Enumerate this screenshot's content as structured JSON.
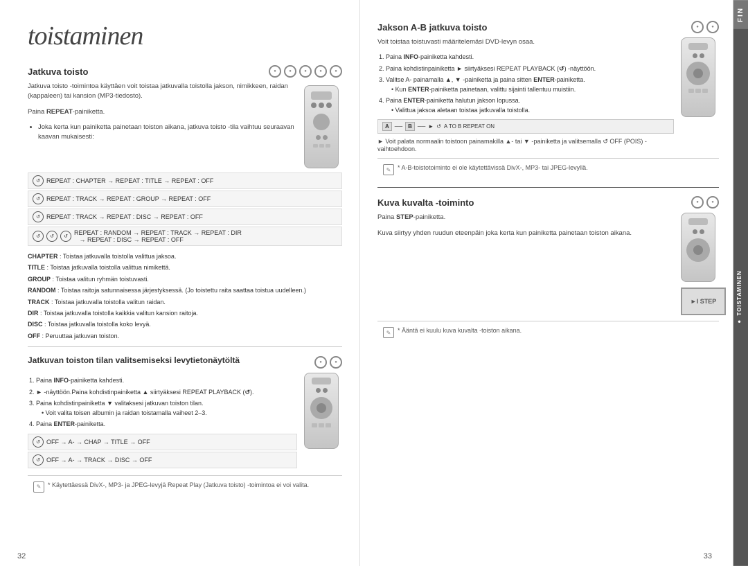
{
  "page": {
    "title": "toistaminen",
    "page_left": "32",
    "page_right": "33"
  },
  "right_tabs": {
    "fin_label": "FIN",
    "toistaminen_label": "● TOISTAMINEN"
  },
  "left_column": {
    "section1": {
      "title": "Jatkuva toisto",
      "icons": [
        "disc1",
        "disc2",
        "disc3",
        "disc4",
        "disc5"
      ],
      "body": "Jatkuva toisto -toimintoa käyttäen voit toistaa jatkuvalla toistolla jakson, nimikkeen, raidan (kappaleen) tai kansion (MP3-tiedosto).",
      "press_label": "Paina REPEAT-painiketta.",
      "bullet1": "Joka kerta kun painiketta painetaan toiston aikana, jatkuva toisto -tila vaihtuu seuraavan kaavan mukaisesti:"
    },
    "repeat_rows": [
      {
        "id": "row1",
        "text": "REPEAT : CHAPTER → REPEAT : TITLE → REPEAT : OFF"
      },
      {
        "id": "row2",
        "text": "REPEAT : TRACK → REPEAT : GROUP → REPEAT : OFF"
      },
      {
        "id": "row3",
        "text": "REPEAT : TRACK → REPEAT : DISC → REPEAT : OFF"
      },
      {
        "id": "row4",
        "text": "REPEAT : RANDOM → REPEAT : TRACK → REPEAT : DIR → REPEAT : DISC → REPEAT : OFF"
      }
    ],
    "definitions": [
      {
        "term": "CHAPTER",
        "desc": ": Toistaa jatkuvalla toistolla valittua jaksoa."
      },
      {
        "term": "TITLE",
        "desc": ": Toistaa jatkuvalla toistolla valittua nimikettä."
      },
      {
        "term": "GROUP",
        "desc": ": Toistaa valitun ryhmän toistuvasti."
      },
      {
        "term": "RANDOM",
        "desc": ": Toistaa raitoja satunnaisessa järjestyksessä. (Jo toistettu raita saattaa toistua uudelleen.)"
      },
      {
        "term": "TRACK",
        "desc": ": Toistaa jatkuvalla toistolla valitun raidan."
      },
      {
        "term": "DIR",
        "desc": ": Toistaa jatkuvalla toistolla kaikkia valitun kansion raitoja."
      },
      {
        "term": "DISC",
        "desc": ": Toistaa jatkuvalla toistolla koko levyä."
      },
      {
        "term": "OFF",
        "desc": ": Peruuttaa jatkuvan toiston."
      }
    ],
    "section2": {
      "title": "Jatkuvan toiston tilan valitsemiseksi levytietonäytöltä",
      "icons": [
        "disc1",
        "disc2"
      ],
      "steps": [
        "Paina INFO-painiketta kahdesti.",
        "► -näyttöön.Paina kohdistinpainiketta ▲ siirtyäksesi REPEAT PLAYBACK (↺).",
        "Paina kohdistinpainiketta ▼ valitaksesi jatkuvan toiston tilan.",
        "• Voit valita toisen albumin ja raidan toistamalla vaiheet 2–3.",
        "Paina ENTER-painiketta."
      ],
      "flow_rows": [
        {
          "id": "flow1",
          "text": "OFF → A- → CHAP → TITLE → OFF"
        },
        {
          "id": "flow2",
          "text": "OFF → A- → TRACK → DISC → OFF"
        }
      ],
      "note": "* Käytettäessä DivX-, MP3- ja JPEG-levyjä Repeat Play (Jatkuva toisto) -toimintoa ei voi valita."
    }
  },
  "right_column": {
    "section1": {
      "title": "Jakson A-B jatkuva toisto",
      "icons": [
        "disc1",
        "disc2"
      ],
      "intro": "Voit toistaa toistuvasti määritelemäsi DVD-levyn osaa.",
      "steps": [
        "Paina INFO-painiketta kahdesti.",
        "Paina kohdistinpainiketta ► siirtyäksesi REPEAT PLAYBACK (↺) -näyttöön.",
        "Valitse A- painamalla ▲, ▼ -painiketta ja paina sitten ENTER-painiketta.",
        "• Kun ENTER-painiketta painetaan, valittu sijainti tallentuu muistiin.",
        "Paina ENTER-painiketta halutun jakson lopussa.",
        "• Valittua jaksoa aletaan toistaa jatkuvalla toistolla."
      ],
      "ab_indicator_items": [
        "A",
        "B",
        "►",
        "A TO B REPEAT ON"
      ],
      "note1": "► Voit palata normaalin toistoon painamakilla ▲- tai ▼ -painiketta ja valitsemalla ↺ OFF (POIS) - vaihtoehdoon.",
      "note2": "* A-B-toistotoiminto ei ole käytettävissä DivX-, MP3- tai JPEG-levyllä."
    },
    "section2": {
      "title": "Kuva kuvalta -toiminto",
      "icons": [
        "disc1",
        "disc2"
      ],
      "intro": "Paina STEP-painiketta.",
      "body": "Kuva siirtyy yhden ruudun eteenpäin joka kerta kun painiketta painetaan toiston aikana.",
      "note": "* Ääntä ei kuulu kuva kuvalta -toiston aikana.",
      "step_display": "►I STEP"
    }
  }
}
